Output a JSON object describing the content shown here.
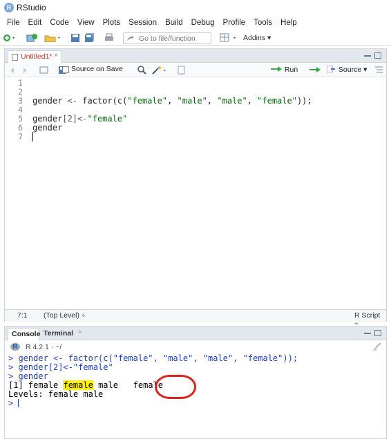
{
  "app": {
    "title": "RStudio",
    "logo_letter": "R"
  },
  "menu": [
    "File",
    "Edit",
    "Code",
    "View",
    "Plots",
    "Session",
    "Build",
    "Debug",
    "Profile",
    "Tools",
    "Help"
  ],
  "toolbar": {
    "goto_placeholder": "Go to file/function",
    "addins_label": "Addins"
  },
  "editor": {
    "tab_label": "Untitled1*",
    "tab_close": "×",
    "source_on_save_label": "Source on Save",
    "run_label": "Run",
    "source_label": "Source",
    "line_numbers": [
      "1",
      "2",
      "3",
      "4",
      "5",
      "6",
      "7"
    ],
    "code": {
      "l3_a": "gender ",
      "l3_op": "<-",
      "l3_b": " factor(c(",
      "l3_s1": "\"female\"",
      "l3_c1": ", ",
      "l3_s2": "\"male\"",
      "l3_c2": ", ",
      "l3_s3": "\"male\"",
      "l3_c3": ", ",
      "l3_s4": "\"female\"",
      "l3_end": "));",
      "l5_a": "gender",
      "l5_idx": "[2]",
      "l5_op": "<-",
      "l5_s": "\"female\"",
      "l6": "gender"
    },
    "status": {
      "position": "7:1",
      "scope": "(Top Level) ÷",
      "file_type": "R Script ÷"
    }
  },
  "console": {
    "tab_console": "Console",
    "tab_terminal": "Terminal",
    "tab_terminal_close": "×",
    "r_version": "R 4.2.1 · ~/",
    "lines": {
      "in1_pre": "> gender <- factor(c(\"female\", ",
      "in1_circled": "\"male\",",
      "in1_post": " \"male\", \"female\"));",
      "in2": "> gender[2]<-\"female\"",
      "in3": "> gender",
      "out1_pre": "[1] female ",
      "out1_hl": "female",
      "out1_post": " male   female",
      "out2": "Levels: female male",
      "prompt": "> "
    }
  },
  "colors": {
    "string_green": "#036a07",
    "console_input_blue": "#1c3ec6",
    "highlight_yellow": "#fff200",
    "annotation_red": "#e0231a",
    "tab_modified_red": "#c0392b"
  }
}
